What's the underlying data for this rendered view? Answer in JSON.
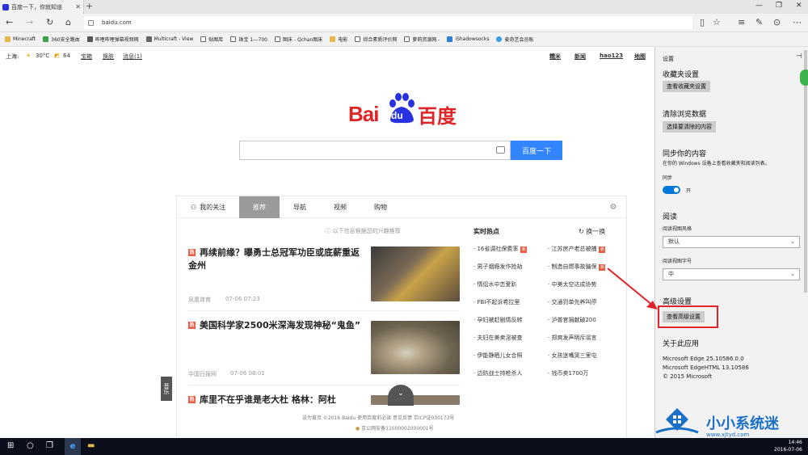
{
  "browser": {
    "tab_title": "百度一下，你就知道",
    "url": "baidu.com"
  },
  "favorites": [
    "Minecraft",
    "360安全路由",
    "哔哩哔哩弹幕视频网",
    "Multicraft - View",
    "贴图库",
    "珠宝 1---700",
    "图床 - Qchan图床",
    "电影",
    "综合素质评价网",
    "萝莉资源网 -",
    "iShadowsocks",
    "麦奇艺会员账"
  ],
  "baidu": {
    "top_left": {
      "city": "上海:",
      "temp": "30°C",
      "aqi": "64",
      "links": [
        "宝箱",
        "换肤",
        "消息(1)"
      ]
    },
    "top_right": [
      "糯米",
      "新闻",
      "hao123",
      "地图"
    ],
    "logo_en": "Bai",
    "logo_du": "du",
    "logo_cn": "百度",
    "search_button": "百度一下",
    "feed_tabs": [
      "我的关注",
      "推荐",
      "导航",
      "视频",
      "购物"
    ],
    "hint": "以下信息根据您的兴趣推荐",
    "news": [
      {
        "badge": "热",
        "title": "再续前缘？曝勇士总冠军功臣或底薪重返金州",
        "source": "凤凰体育",
        "time": "07-06 07:23"
      },
      {
        "badge": "热",
        "title": "美国科学家2500米深海发现神秘“鬼鱼”",
        "source": "中国日报网",
        "time": "07-06 08:01"
      },
      {
        "badge": "热",
        "title": "库里不在乎谁是老大杜 格林：阿杜"
      }
    ],
    "hot_title": "实时热点",
    "refresh": "换一换",
    "hot_left": [
      "16省调社保费率",
      "男子烟瘾发作抢劫",
      "情侣水中恋爱趴",
      "FBI不起诉希拉里",
      "孕妇被赶剧情反转",
      "夫妇在美卖淫被查",
      "伊能静晒儿女合照",
      "边防战士持枪杀人"
    ],
    "hot_right": [
      "江苏房产老总被捕",
      "制造自燃事故骗保",
      "中美太空达成协势",
      "交通罚单先养叫停",
      "泸普官捐献破200",
      "郑爽发声明斥谣言",
      "女孩迷嘴哭三里屯",
      "钱币卖1700万"
    ],
    "hot_badge": "新",
    "music": "音乐",
    "footer1": "设为首页  ©2016 Baidu 使用百度前必读 意见反馈 京ICP证030173号",
    "footer2": "京公网安备11000002000001号"
  },
  "settings": {
    "title": "设置",
    "fav_head": "收藏夹设置",
    "fav_btn": "查看收藏夹设置",
    "clear_head": "清除浏览数据",
    "clear_btn": "选择要清除的内容",
    "sync_head": "同步你的内容",
    "sync_desc": "在你的 Windows 设备上查看收藏夹和阅读列表。",
    "sync_label": "同步",
    "sync_state": "开",
    "read_head": "阅读",
    "read_style_label": "阅读视图风格",
    "read_style_value": "默认",
    "read_font_label": "阅读视图字号",
    "read_font_value": "中",
    "adv_head": "高级设置",
    "adv_btn": "查看高级设置",
    "about_head": "关于此应用",
    "about1": "Microsoft Edge 25.10586.0.0",
    "about2": "Microsoft EdgeHTML 13.10586",
    "about3": "© 2015 Microsoft"
  },
  "watermark": {
    "text": "小小系统迷",
    "url": "www.xjtyd.com"
  },
  "clock": {
    "time": "14:46",
    "date": "2016-07-06"
  },
  "colors": {
    "accent": "#3385ff",
    "baidu_red": "#de2424",
    "baidu_blue": "#2932e1",
    "toggle": "#0078d7",
    "highlight": "#e0242a"
  }
}
